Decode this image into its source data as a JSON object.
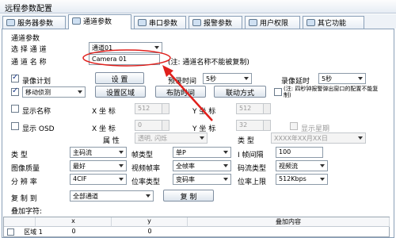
{
  "window": {
    "title": "远程参数配置"
  },
  "tabs": [
    {
      "label": "服务器参数"
    },
    {
      "label": "通道参数"
    },
    {
      "label": "串口参数"
    },
    {
      "label": "报警参数"
    },
    {
      "label": "用户权限"
    },
    {
      "label": "其它功能"
    }
  ],
  "group": {
    "title": "通道参数"
  },
  "channel": {
    "select_label": "选 择 通 道",
    "select_value": "通道01",
    "name_label": "通 道 名 称",
    "name_value": "Camera 01",
    "name_note": "(注: 通道名称不能被复制)"
  },
  "record": {
    "plan_label": "录像计划",
    "setup_button": "设 置",
    "prerecord_label": "预录时间",
    "prerecord_value": "5秒",
    "delay_label": "录像延时",
    "delay_value": "5秒"
  },
  "motion": {
    "select_value": "移动侦测",
    "area_button": "设置区域",
    "time_button": "布防时间",
    "link_button": "联动方式",
    "cb_label": "(注: 四秒钟报警弹出窗口的配置不能复制)"
  },
  "osd_name": {
    "label": "显示名称",
    "x_label": "X 坐 标",
    "x_value": "512",
    "y_label": "Y 坐 标",
    "y_value": "512"
  },
  "osd": {
    "label": "显示 OSD",
    "x_label": "X 坐 标",
    "x_value": "0",
    "y_label": "Y 坐 标",
    "y_value": "32",
    "week_label": "显示星期",
    "attr_label": "属 性",
    "attr_value": "透明, 闪烁",
    "type_label": "类 型",
    "type_value": "XXXX年XX月XX日"
  },
  "stream": {
    "type_label": "类 型",
    "type_value": "主码流",
    "frame_type_label": "帧类型",
    "frame_type_value": "单P",
    "iframe_label": "I 帧间隔",
    "iframe_value": "100",
    "quality_label": "图像质量",
    "quality_value": "最好",
    "fps_label": "视频帧率",
    "fps_value": "全帧率",
    "stream_type_label": "码流类型",
    "stream_type_value": "视频流",
    "res_label": "分 辨 率",
    "res_value": "4CIF",
    "bitrate_type_label": "位率类型",
    "bitrate_type_value": "变码率",
    "bitrate_max_label": "位率上限",
    "bitrate_max_value": "512Kbps"
  },
  "copy": {
    "label": "复 制 到",
    "value": "全部通道",
    "button": "复 制"
  },
  "overlay": {
    "label": "叠加字符:",
    "headers": [
      "",
      "x",
      "y",
      "叠加内容"
    ],
    "row": {
      "name": "区域 1",
      "x": "0",
      "y": "0",
      "content": ""
    }
  },
  "colors": {
    "arrow": "#e0201c",
    "highlight": "#e0201c"
  }
}
